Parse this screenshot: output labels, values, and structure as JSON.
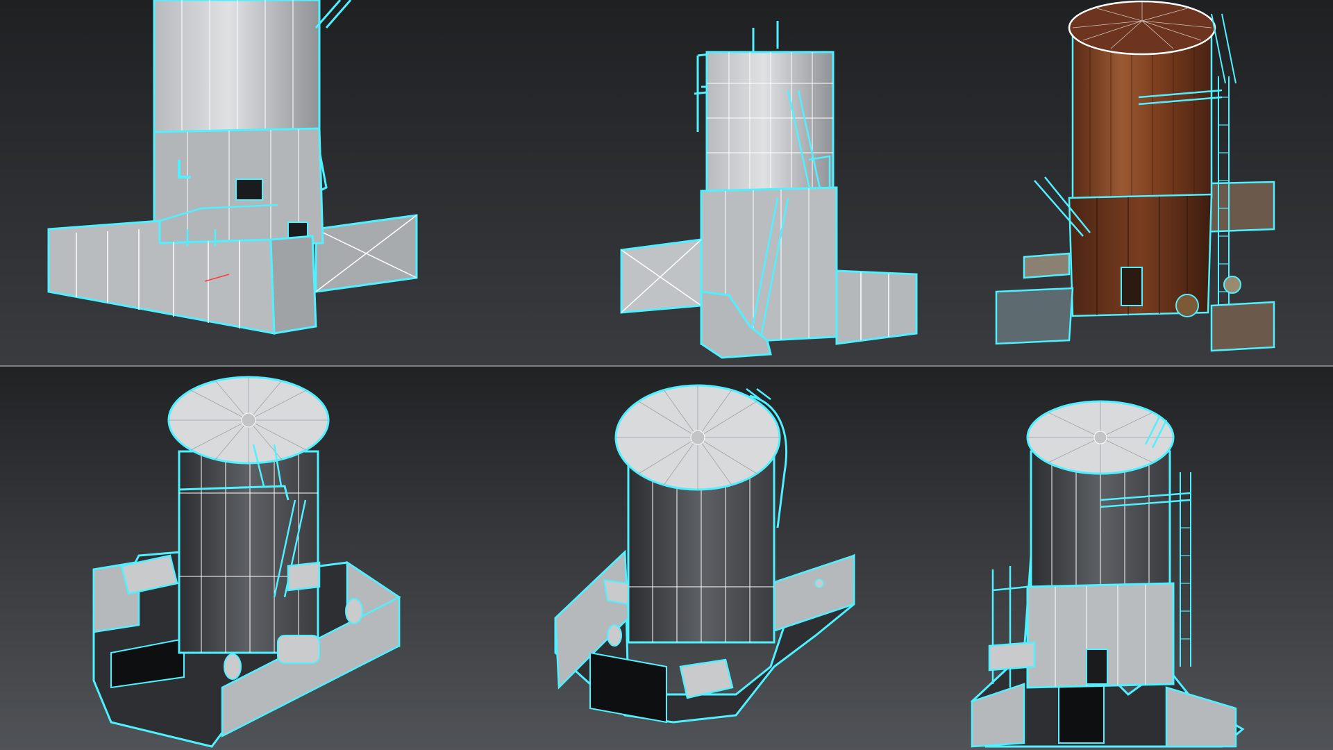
{
  "layout": {
    "columns": 3,
    "rows": 2
  },
  "style": {
    "background_top": "#1f2022",
    "background_bottom": "#55585d",
    "divider": "#7d8086",
    "wire": "#4ff0ff",
    "edge": "#ffffff",
    "shade_light": "#d2d4d6",
    "shade_mid": "#a8abae",
    "shade_dark": "#3c3e42",
    "rust_dark": "#5a2a16",
    "rust_mid": "#8b4a28",
    "rust_light": "#b97a4d",
    "gizmo_x": "#ff3b3b"
  },
  "viewports": [
    {
      "id": "vp-1",
      "render": "wireframe-shaded",
      "view": "close-up-base",
      "roof": false
    },
    {
      "id": "vp-2",
      "render": "wireframe-shaded",
      "view": "side",
      "roof": false
    },
    {
      "id": "vp-3",
      "render": "textured-rusty",
      "view": "perspective",
      "roof": true
    },
    {
      "id": "vp-4",
      "render": "wireframe-shaded",
      "view": "top-down",
      "roof": true
    },
    {
      "id": "vp-5",
      "render": "wireframe-shaded",
      "view": "top-down-rotated",
      "roof": true
    },
    {
      "id": "vp-6",
      "render": "wireframe-shaded",
      "view": "perspective",
      "roof": true
    }
  ]
}
